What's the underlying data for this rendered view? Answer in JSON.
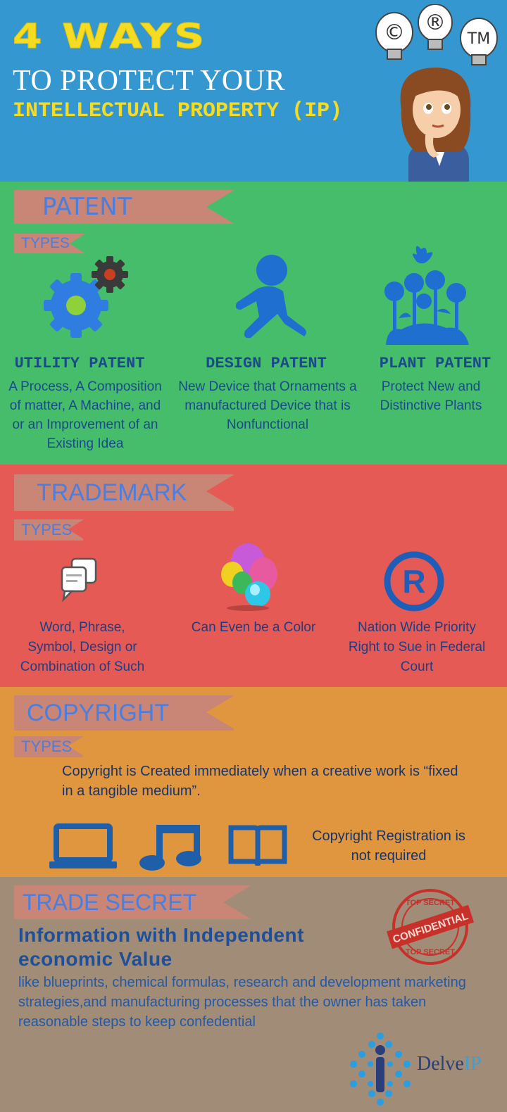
{
  "header": {
    "line1": "4 WAYS",
    "line2": "TO PROTECT YOUR",
    "line3": "INTELLECTUAL PROPERTY (IP)",
    "bulb_icons": [
      "copyright-icon",
      "registered-icon",
      "trademark-icon"
    ],
    "bulb_labels": [
      "©",
      "®",
      "TM"
    ]
  },
  "patent": {
    "heading": "PATENT",
    "types_label": "TYPES",
    "items": [
      {
        "icon": "gears-icon",
        "title": "UTILITY PATENT",
        "text": "A Process, A Composition of matter, A Machine, and or an Improvement of an Existing Idea"
      },
      {
        "icon": "person-icon",
        "title": "DESIGN PATENT",
        "text": "New Device that Ornaments a manufactured Device that is Nonfunctional"
      },
      {
        "icon": "plants-icon",
        "title": "PLANT PATENT",
        "text": "Protect New and Distinctive Plants"
      }
    ]
  },
  "trademark": {
    "heading": "TRADEMARK",
    "types_label": "TYPES",
    "items": [
      {
        "icon": "chat-bubbles-icon",
        "text": "Word, Phrase, Symbol, Design or Combination of Such"
      },
      {
        "icon": "color-bubbles-icon",
        "text": "Can Even be a Color"
      },
      {
        "icon": "registered-icon",
        "text": "Nation Wide Priority Right to Sue in Federal Court"
      }
    ],
    "registered_symbol": "R"
  },
  "copyright": {
    "heading": "COPYRIGHT",
    "types_label": "TYPES",
    "text": "Copyright is Created immediately when a creative work is “fixed in a tangible medium”.",
    "icons": [
      "laptop-icon",
      "music-note-icon",
      "book-icon"
    ],
    "registration_text": "Copyright Registration is not required"
  },
  "trade_secret": {
    "heading": "TRADE SECRET",
    "title": "Information with Independent economic Value",
    "text": "like blueprints, chemical formulas, research and development marketing strategies,and manufacturing processes that the owner has taken reasonable steps to keep confedential",
    "stamp": {
      "top": "TOP SECRET",
      "middle": "CONFIDENTIAL",
      "bottom": "TOP SECRET"
    },
    "logo_text_a": "Delve",
    "logo_text_b": "IP"
  },
  "colors": {
    "header": "#3597cf",
    "patent": "#45bd6a",
    "trademark": "#e55a55",
    "copyright": "#e0963f",
    "trade_secret": "#a08c77",
    "banner": "#c98576",
    "accent_yellow": "#f5dc23"
  }
}
